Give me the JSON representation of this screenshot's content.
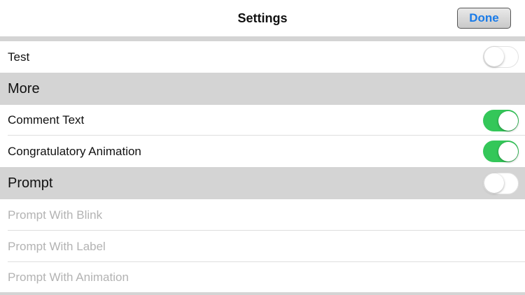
{
  "nav": {
    "title": "Settings",
    "done_label": "Done",
    "done_color": "#1a7be8"
  },
  "rows": {
    "test": {
      "label": "Test",
      "toggle": "off"
    },
    "comment_text": {
      "label": "Comment Text",
      "toggle": "on"
    },
    "congratulatory_animation": {
      "label": "Congratulatory Animation",
      "toggle": "on"
    },
    "prompt_with_blink": {
      "label": "Prompt With Blink",
      "enabled": false
    },
    "prompt_with_label": {
      "label": "Prompt With Label",
      "enabled": false
    },
    "prompt_with_animation": {
      "label": "Prompt With Animation",
      "enabled": false
    }
  },
  "sections": {
    "more": {
      "label": "More"
    },
    "prompt": {
      "label": "Prompt",
      "toggle": "off"
    }
  },
  "colors": {
    "toggle_on": "#34c759",
    "section_bg": "#d4d4d4",
    "disabled_text": "#b3b3b3"
  }
}
